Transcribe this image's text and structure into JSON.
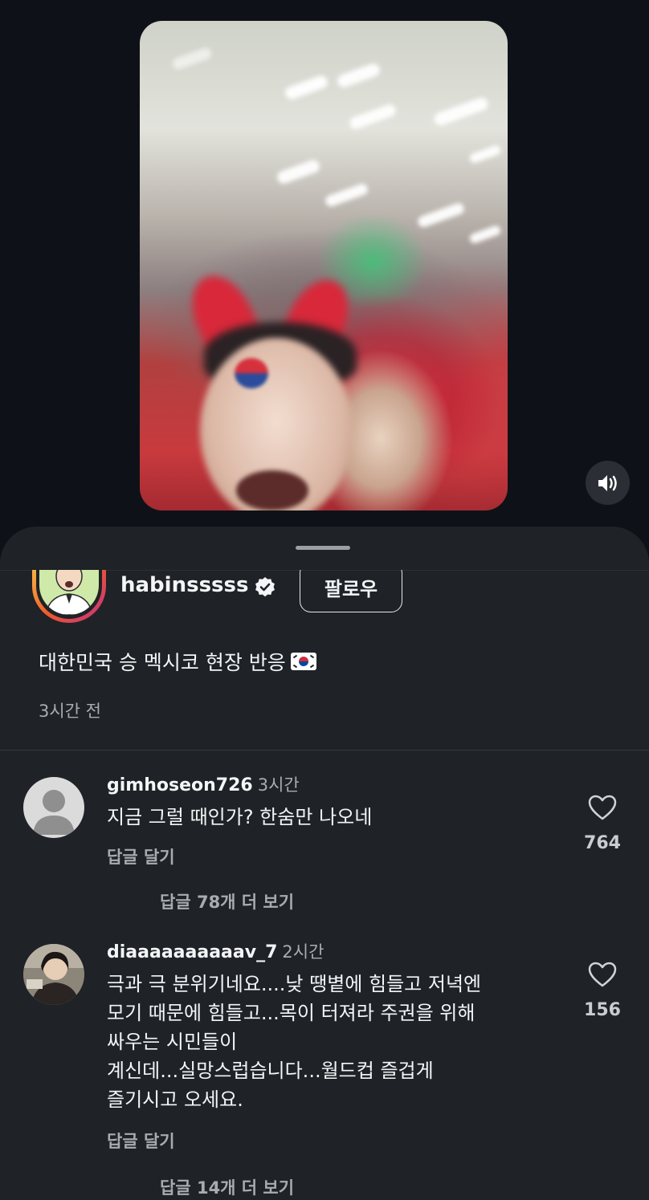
{
  "video": {
    "sound_icon": "speaker-on-icon"
  },
  "post": {
    "username": "habinsssss",
    "verified_icon": "verified-badge-icon",
    "follow_label": "팔로우",
    "caption": "대한민국 승 멕시코 현장 반응",
    "caption_emoji": "korea-flag-icon",
    "timestamp": "3시간 전"
  },
  "comments": [
    {
      "username": "gimhoseon726",
      "time": "3시간",
      "text": "지금 그럴 때인가? 한숨만 나오네",
      "reply_label": "답글 달기",
      "likes": "764",
      "more_replies": "답글 78개 더 보기"
    },
    {
      "username": "diaaaaaaaaaav_7",
      "time": "2시간",
      "text": "극과 극 분위기네요....낮 땡볕에 힘들고 저녁엔\n모기 때문에 힘들고...목이 터져라 주권을 위해\n싸우는 시민들이\n계신데...실망스럽습니다...월드컵 즐겁게\n즐기시고 오세요.",
      "reply_label": "답글 달기",
      "likes": "156",
      "more_replies": "답글 14개 더 보기"
    }
  ],
  "colors": {
    "background": "#0e1218",
    "sheet": "#1f2226",
    "text_primary": "#f3f5f7",
    "text_secondary": "#a8acb2"
  }
}
